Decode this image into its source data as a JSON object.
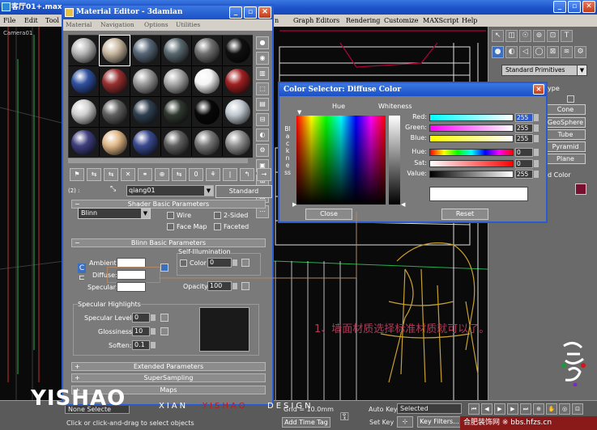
{
  "window": {
    "title": "客厅01+.max",
    "menu": [
      "File",
      "Edit",
      "Tool"
    ],
    "menu_right": [
      "Graph Editors",
      "Rendering",
      "Customize",
      "MAXScript",
      "Help"
    ],
    "menu_fragment": "n",
    "title_fragment": "se",
    "viewport_label": "Camera01"
  },
  "material_editor": {
    "title": "Material Editor - 3damian",
    "menu": [
      "Material",
      "Navigation",
      "Options",
      "Utilities"
    ],
    "slot_colors": [
      [
        "#b8b8b8",
        "#c8b8a0",
        "#586878",
        "#5a6a70",
        "#707070",
        "#101010"
      ],
      [
        "#3050a0",
        "#983030",
        "#9a9a9a",
        "#a8a8a8",
        "#f4f4f4",
        "#a02020"
      ],
      [
        "#d0d0d0",
        "#606060",
        "#304050",
        "#303830",
        "#080808",
        "#c0c8d0"
      ],
      [
        "#404080",
        "#e0b888",
        "#3a4a90",
        "#606060",
        "#787878",
        "#909090"
      ]
    ],
    "side_tools": [
      "●",
      "◉",
      "▥",
      "⬚",
      "▤",
      "⊟",
      "◐",
      "⚙",
      "▣",
      "⊞",
      "⬔",
      "⋯"
    ],
    "toolbar_icons": [
      "⚑",
      "⇆",
      "⇆",
      "✕",
      "⚭",
      "⊕",
      "⇆",
      "0",
      "⚘",
      "|",
      "↰",
      "→"
    ],
    "slot_label": "(2) :",
    "material_name": "qiang01",
    "material_type": "Standard",
    "shader_basic": {
      "header": "Shader Basic Parameters",
      "shader": "Blinn",
      "wire": "Wire",
      "two_sided": "2-Sided",
      "face_map": "Face Map",
      "faceted": "Faceted"
    },
    "blinn_basic": {
      "header": "Blinn Basic Parameters",
      "self_illum": "Self-Illumination",
      "ambient": "Ambient:",
      "diffuse": "Diffuse:",
      "specular": "Specular:",
      "color": "Color",
      "color_value": "0",
      "opacity": "Opacity:",
      "opacity_value": "100",
      "lock_symbol": "C",
      "ambient_color": "#ffffff",
      "diffuse_color": "#ffffff",
      "specular_color": "#ffffff"
    },
    "specular_highlights": {
      "header": "Specular Highlights",
      "level_label": "Specular Level:",
      "level": "0",
      "gloss_label": "Glossiness:",
      "gloss": "10",
      "soften_label": "Soften:",
      "soften": "0.1"
    },
    "extended": "Extended Parameters",
    "supersampling": "SuperSampling",
    "maps": "Maps"
  },
  "color_selector": {
    "title": "Color Selector: Diffuse Color",
    "hue_caption": "Hue",
    "whiteness_caption": "Whiteness",
    "blackness_caption": "Blackness",
    "rows": [
      {
        "label": "Red:",
        "value": "255",
        "highlight": true
      },
      {
        "label": "Green:",
        "value": "255",
        "highlight": false
      },
      {
        "label": "Blue:",
        "value": "255",
        "highlight": false
      },
      {
        "label": "Hue:",
        "value": "0",
        "highlight": false
      },
      {
        "label": "Sat:",
        "value": "0",
        "highlight": false
      },
      {
        "label": "Value:",
        "value": "255",
        "highlight": false
      }
    ],
    "close": "Close",
    "reset": "Reset",
    "current_color": "#ffffff"
  },
  "command_panel": {
    "tabs_row1": [
      "↖",
      "◫",
      "☉",
      "⊚",
      "⊡",
      "T"
    ],
    "tabs_row2": [
      "●",
      "◐",
      "◁",
      "◯",
      "⊠",
      "≋",
      "⚙"
    ],
    "category": "Standard Primitives",
    "type_fragment": "ype",
    "primitives": [
      "Cone",
      "GeoSphere",
      "Tube",
      "Pyramid",
      "Plane"
    ],
    "color_fragment": "d Color",
    "swatch_color": "#7a1030"
  },
  "status": {
    "none_selected": "None Selecte",
    "prompt": "Click or click-and-drag to select objects",
    "grid": "Grid = 10.0mm",
    "add_time_tag": "Add Time Tag",
    "auto_key": "Auto Key",
    "set_key": "Set Key",
    "selected": "Selected",
    "key_filters": "Key Filters..."
  },
  "overlay": {
    "brand": "YISHAO",
    "brand_sub1": "XIAN",
    "brand_sub2": "YISHAO",
    "brand_sub3": "DESIGN",
    "note": "1、墙面材质选择标准材质就可以了。",
    "site": "合肥装饰网 ※ bbs.hfzs.cn"
  }
}
